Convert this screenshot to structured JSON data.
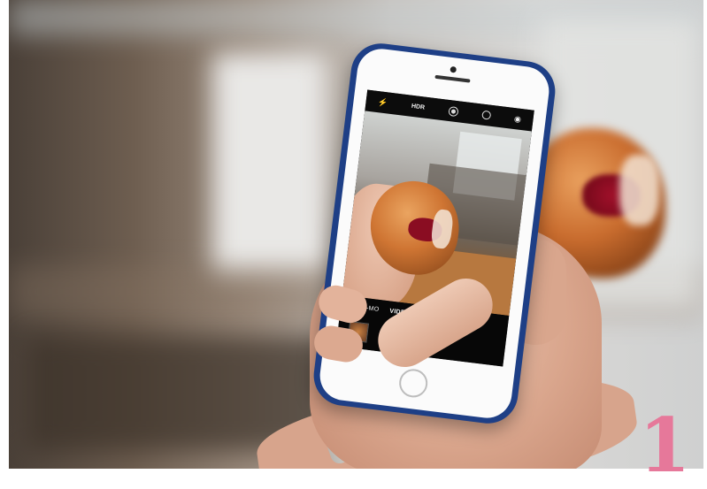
{
  "camera_app": {
    "top_bar": {
      "hdr_label": "HDR"
    },
    "modes": [
      "SLO-MO",
      "VIDEO"
    ]
  },
  "overlay": {
    "page_number": "1",
    "page_number_color": "#e6789a"
  }
}
